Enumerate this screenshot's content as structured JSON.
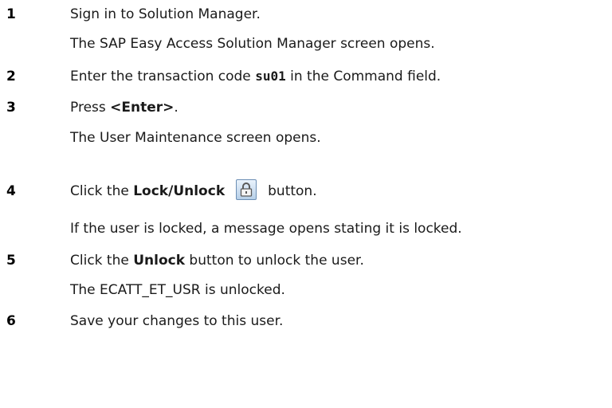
{
  "steps": [
    {
      "number": "1",
      "text": "Sign in to Solution Manager.",
      "result": "The SAP Easy Access Solution Manager screen opens."
    },
    {
      "number": "2",
      "text_before": "Enter the transaction code ",
      "code": "su01",
      "text_after": " in the Command field."
    },
    {
      "number": "3",
      "text_before": "Press ",
      "bold": "<Enter>",
      "text_after": ".",
      "result": "The User Maintenance screen opens."
    },
    {
      "number": "4",
      "text_before": "Click the ",
      "bold": "Lock/Unlock",
      "text_after": "button.",
      "icon": "lock-icon",
      "result": "If the user is locked, a message opens stating it is locked."
    },
    {
      "number": "5",
      "text_before": "Click the ",
      "bold": "Unlock",
      "text_after": " button to unlock the user.",
      "result": "The ECATT_ET_USR is unlocked."
    },
    {
      "number": "6",
      "text": "Save your changes to this user."
    }
  ]
}
